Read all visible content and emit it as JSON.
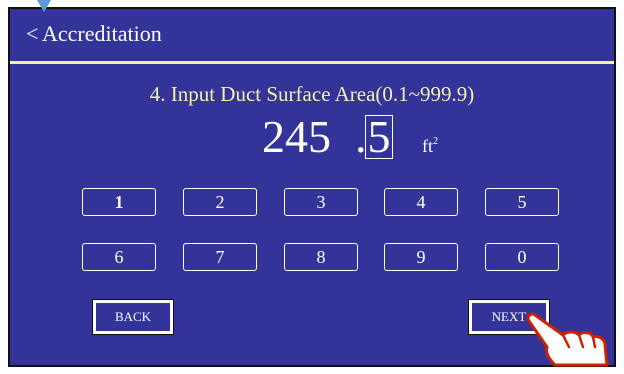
{
  "header": {
    "back_symbol": "<",
    "title": "Accreditation"
  },
  "prompt": "4. Input Duct Surface Area(0.1~999.9)",
  "value": {
    "integer": "245",
    "dot": ".",
    "cursor_digit": "5",
    "unit": "ft",
    "unit_exponent": "2"
  },
  "keypad": {
    "row1": [
      "1",
      "2",
      "3",
      "4",
      "5"
    ],
    "row2": [
      "6",
      "7",
      "8",
      "9",
      "0"
    ]
  },
  "buttons": {
    "back": "BACK",
    "next": "NEXT"
  },
  "colors": {
    "panel": "#333399",
    "prompt": "#f5f0b0",
    "divider": "#f2f2b8",
    "hand": "#cc2200"
  },
  "icons": {
    "pointer": "pointing-hand-icon",
    "marker": "triangle-marker-icon"
  }
}
